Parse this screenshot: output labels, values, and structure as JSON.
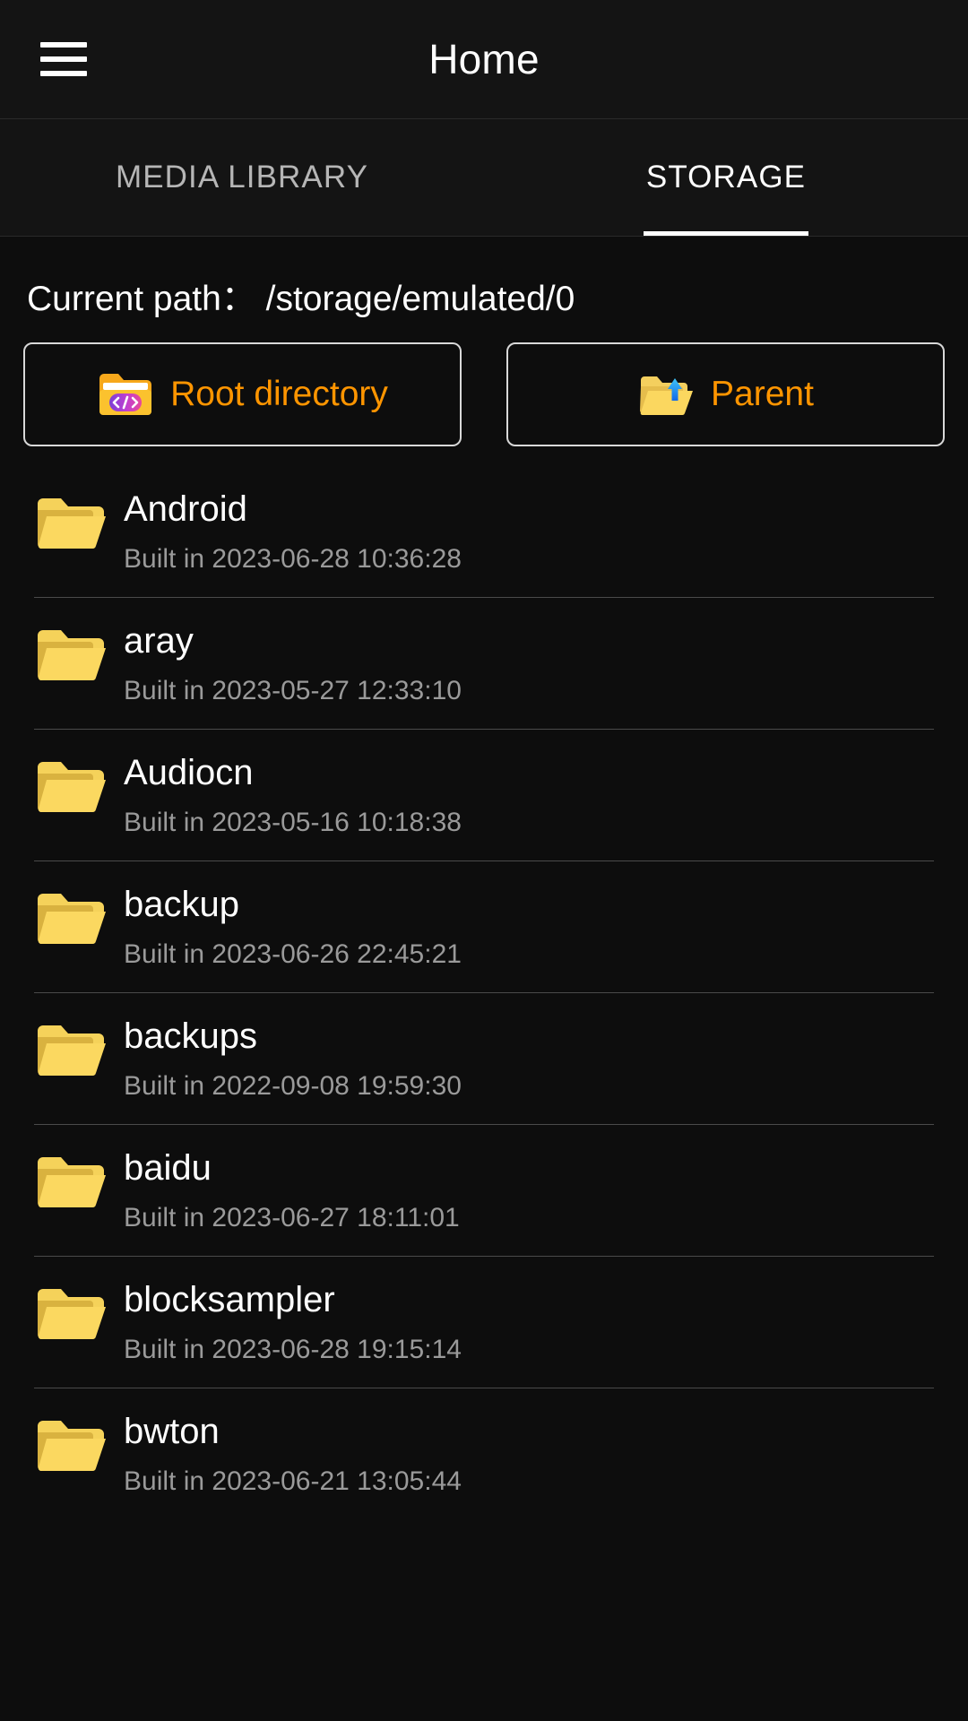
{
  "header": {
    "title": "Home",
    "menu_icon": "hamburger-menu-icon"
  },
  "tabs": [
    {
      "label": "MEDIA LIBRARY",
      "active": false
    },
    {
      "label": "STORAGE",
      "active": true
    }
  ],
  "path": {
    "label": "Current path：",
    "value": "/storage/emulated/0",
    "full": "Current path： /storage/emulated/0"
  },
  "nav_buttons": [
    {
      "label": "Root directory",
      "icon": "folder-code-icon"
    },
    {
      "label": "Parent",
      "icon": "folder-up-arrow-icon"
    }
  ],
  "colors": {
    "accent_orange": "#ff9500",
    "folder_yellow": "#f6d34a",
    "background": "#0d0d0d",
    "surface": "#141414",
    "text_primary": "#ffffff",
    "text_secondary": "#9a9a9a"
  },
  "files": [
    {
      "name": "Android",
      "meta": "Built in 2023-06-28 10:36:28",
      "icon": "folder-icon"
    },
    {
      "name": "aray",
      "meta": "Built in 2023-05-27 12:33:10",
      "icon": "folder-icon"
    },
    {
      "name": "Audiocn",
      "meta": "Built in 2023-05-16 10:18:38",
      "icon": "folder-icon"
    },
    {
      "name": "backup",
      "meta": "Built in 2023-06-26 22:45:21",
      "icon": "folder-icon"
    },
    {
      "name": "backups",
      "meta": "Built in 2022-09-08 19:59:30",
      "icon": "folder-icon"
    },
    {
      "name": "baidu",
      "meta": "Built in 2023-06-27 18:11:01",
      "icon": "folder-icon"
    },
    {
      "name": "blocksampler",
      "meta": "Built in 2023-06-28 19:15:14",
      "icon": "folder-icon"
    },
    {
      "name": "bwton",
      "meta": "Built in 2023-06-21 13:05:44",
      "icon": "folder-icon"
    }
  ]
}
